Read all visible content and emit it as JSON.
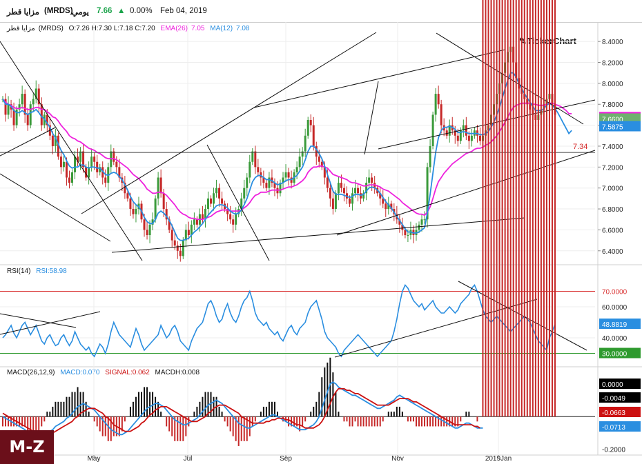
{
  "header": {
    "name": "مزايا قطر",
    "symbol": "(MRDS)",
    "period": "يومي",
    "last": "7.66",
    "change": "0.00%",
    "date": "Feb 04, 2019",
    "up_color": "#1aa34a"
  },
  "watermark": "TickerChart",
  "logo_text": "M-Z",
  "price_legend": {
    "name": "مزايا قطر",
    "symbol": "(MRDS)",
    "ohlc": "O:7.26  H:7.30  L:7.18  C:7.20",
    "ema_label": "EMA(26)",
    "ema_value": "7.05",
    "ma_label": "MA(12)",
    "ma_value": "7.08"
  },
  "rsi_legend": {
    "label": "RSI(14)",
    "value": "RSI:58.98"
  },
  "macd_legend": {
    "label": "MACD(26,12,9)",
    "macd": "MACD:0.070",
    "signal": "SIGNAL:0.062",
    "macdh": "MACDH:0.008"
  },
  "colors": {
    "ema": "#ee22dd",
    "ma": "#2a8ee0",
    "up": "#3a9a3a",
    "down": "#c62828",
    "macd_line": "#2a8ee0",
    "signal_line": "#cc1111",
    "hist_up": "#111111",
    "hist_down": "#c62828",
    "overbought": "#d93030",
    "oversold": "#2e9a2e"
  },
  "chart_data": [
    {
      "type": "candlestick",
      "title": "مزايا قطر (MRDS)",
      "x_tick_labels": [
        "May",
        "Jul",
        "Sep",
        "Nov",
        "2019Jan"
      ],
      "y_tick_labels": [
        "8.4000",
        "8.2000",
        "8.0000",
        "7.8000",
        "7.6000",
        "7.4000",
        "7.2000",
        "7.0000",
        "6.8000",
        "6.6000",
        "6.4000"
      ],
      "ylim": [
        6.28,
        8.48
      ],
      "n_bars": 200,
      "close": [
        7.85,
        7.7,
        7.8,
        7.75,
        7.6,
        7.75,
        7.8,
        7.9,
        7.7,
        7.6,
        7.8,
        7.85,
        7.95,
        7.8,
        7.6,
        7.7,
        7.6,
        7.5,
        7.4,
        7.5,
        7.3,
        7.2,
        7.25,
        7.1,
        7.05,
        7.15,
        7.3,
        7.25,
        7.35,
        7.2,
        7.1,
        7.2,
        7.3,
        7.25,
        7.15,
        7.2,
        7.1,
        7.05,
        7.2,
        7.35,
        7.25,
        7.2,
        7.1,
        7.05,
        6.95,
        6.9,
        6.8,
        6.75,
        6.8,
        6.85,
        6.7,
        6.6,
        6.55,
        6.65,
        6.7,
        6.9,
        7.1,
        6.95,
        6.8,
        6.7,
        6.6,
        6.5,
        6.45,
        6.4,
        6.35,
        6.5,
        6.6,
        6.55,
        6.65,
        6.7,
        6.65,
        6.75,
        6.7,
        6.8,
        6.9,
        6.85,
        6.95,
        7.0,
        6.9,
        6.85,
        6.8,
        6.75,
        6.7,
        6.65,
        6.75,
        6.8,
        6.9,
        7.0,
        7.1,
        7.25,
        7.35,
        7.2,
        7.15,
        7.1,
        7.05,
        7.0,
        7.1,
        7.05,
        7.0,
        6.95,
        7.05,
        7.1,
        7.15,
        7.1,
        7.05,
        7.15,
        7.2,
        7.3,
        7.35,
        7.5,
        7.65,
        7.6,
        7.4,
        7.3,
        7.25,
        7.2,
        7.1,
        7.0,
        6.9,
        6.8,
        6.95,
        7.05,
        7.0,
        6.95,
        6.9,
        6.85,
        6.95,
        7.0,
        6.95,
        6.9,
        6.95,
        7.05,
        7.1,
        7.05,
        7.0,
        6.95,
        6.9,
        6.85,
        6.8,
        6.85,
        6.8,
        6.75,
        6.7,
        6.65,
        6.6,
        6.55,
        6.55,
        6.6,
        6.55,
        6.6,
        6.65,
        6.7,
        6.7,
        7.2,
        7.4,
        7.7,
        7.9,
        7.8,
        7.6,
        7.55,
        7.5,
        7.6,
        7.55,
        7.5,
        7.45,
        7.55,
        7.6,
        7.5,
        7.45,
        7.5,
        7.55,
        7.5,
        7.45,
        7.5,
        7.55,
        7.6,
        7.7,
        7.8,
        7.9,
        8.0,
        8.1,
        8.2,
        8.3,
        8.35,
        8.2,
        8.05,
        7.95,
        7.9,
        7.85,
        7.8,
        7.75,
        7.7,
        7.65,
        7.7,
        7.75,
        7.8,
        7.85,
        7.9,
        7.8,
        7.7,
        7.6,
        7.5,
        7.45,
        7.4,
        7.35,
        7.66
      ],
      "ma12": [
        7.85,
        7.8,
        7.8,
        7.78,
        7.74,
        7.72,
        7.72,
        7.74,
        7.72,
        7.7,
        7.72,
        7.73,
        7.75,
        7.72,
        7.68,
        7.66,
        7.62,
        7.58,
        7.52,
        7.48,
        7.42,
        7.36,
        7.32,
        7.26,
        7.21,
        7.19,
        7.2,
        7.2,
        7.22,
        7.22,
        7.2,
        7.19,
        7.2,
        7.2,
        7.19,
        7.19,
        7.16,
        7.13,
        7.12,
        7.14,
        7.15,
        7.14,
        7.11,
        7.08,
        7.03,
        6.98,
        6.92,
        6.87,
        6.84,
        6.82,
        6.78,
        6.72,
        6.68,
        6.66,
        6.66,
        6.7,
        6.76,
        6.78,
        6.76,
        6.73,
        6.69,
        6.64,
        6.58,
        6.52,
        6.5,
        6.5,
        6.51,
        6.52,
        6.55,
        6.58,
        6.6,
        6.63,
        6.66,
        6.7,
        6.74,
        6.77,
        6.8,
        6.83,
        6.84,
        6.84,
        6.83,
        6.81,
        6.78,
        6.76,
        6.75,
        6.76,
        6.79,
        6.84,
        6.9,
        6.98,
        7.06,
        7.1,
        7.12,
        7.12,
        7.1,
        7.08,
        7.08,
        7.07,
        7.05,
        7.03,
        7.04,
        7.05,
        7.07,
        7.08,
        7.08,
        7.1,
        7.12,
        7.16,
        7.2,
        7.27,
        7.35,
        7.4,
        7.4,
        7.37,
        7.33,
        7.28,
        7.21,
        7.13,
        7.05,
        6.97,
        6.94,
        6.94,
        6.94,
        6.93,
        6.92,
        6.91,
        6.92,
        6.94,
        6.94,
        6.93,
        6.94,
        6.97,
        7.0,
        7.01,
        7.0,
        6.98,
        6.95,
        6.91,
        6.87,
        6.84,
        6.81,
        6.77,
        6.73,
        6.69,
        6.65,
        6.61,
        6.58,
        6.58,
        6.57,
        6.57,
        6.58,
        6.6,
        6.62,
        6.76,
        6.94,
        7.14,
        7.34,
        7.48,
        7.55,
        7.58,
        7.58,
        7.59,
        7.58,
        7.56,
        7.53,
        7.53,
        7.54,
        7.53,
        7.52,
        7.52,
        7.52,
        7.52,
        7.51,
        7.51,
        7.52,
        7.54,
        7.58,
        7.63,
        7.7,
        7.77,
        7.86,
        7.95,
        8.03,
        8.1,
        8.1,
        8.06,
        8.0,
        7.95,
        7.9,
        7.86,
        7.82,
        7.78,
        7.74,
        7.74,
        7.74,
        7.76,
        7.79,
        7.81,
        7.79,
        7.76,
        7.72,
        7.67,
        7.62,
        7.57,
        7.52,
        7.55
      ],
      "ema26": [
        7.85,
        7.82,
        7.8,
        7.79,
        7.77,
        7.76,
        7.76,
        7.77,
        7.76,
        7.75,
        7.75,
        7.76,
        7.77,
        7.77,
        7.75,
        7.75,
        7.73,
        7.71,
        7.68,
        7.67,
        7.64,
        7.6,
        7.57,
        7.54,
        7.5,
        7.48,
        7.47,
        7.45,
        7.44,
        7.42,
        7.4,
        7.38,
        7.37,
        7.36,
        7.34,
        7.33,
        7.31,
        7.29,
        7.28,
        7.28,
        7.28,
        7.27,
        7.25,
        7.23,
        7.21,
        7.19,
        7.16,
        7.13,
        7.11,
        7.09,
        7.06,
        7.03,
        6.99,
        6.97,
        6.95,
        6.95,
        6.96,
        6.96,
        6.95,
        6.93,
        6.9,
        6.87,
        6.84,
        6.8,
        6.77,
        6.75,
        6.74,
        6.72,
        6.71,
        6.71,
        6.7,
        6.7,
        6.7,
        6.71,
        6.72,
        6.73,
        6.75,
        6.77,
        6.78,
        6.79,
        6.79,
        6.79,
        6.78,
        6.78,
        6.78,
        6.78,
        6.79,
        6.81,
        6.83,
        6.86,
        6.9,
        6.93,
        6.94,
        6.96,
        6.96,
        6.96,
        6.97,
        6.98,
        6.98,
        6.98,
        6.98,
        6.99,
        7.0,
        7.01,
        7.01,
        7.02,
        7.03,
        7.05,
        7.07,
        7.1,
        7.15,
        7.18,
        7.2,
        7.2,
        7.21,
        7.21,
        7.2,
        7.19,
        7.16,
        7.13,
        7.12,
        7.11,
        7.1,
        7.09,
        7.08,
        7.06,
        7.05,
        7.05,
        7.04,
        7.03,
        7.02,
        7.02,
        7.03,
        7.03,
        7.03,
        7.02,
        7.01,
        6.99,
        6.98,
        6.97,
        6.95,
        6.93,
        6.91,
        6.89,
        6.86,
        6.84,
        6.82,
        6.8,
        6.78,
        6.76,
        6.75,
        6.75,
        6.74,
        6.77,
        6.82,
        6.9,
        6.99,
        7.06,
        7.1,
        7.14,
        7.17,
        7.2,
        7.23,
        7.25,
        7.27,
        7.29,
        7.31,
        7.33,
        7.34,
        7.35,
        7.37,
        7.38,
        7.38,
        7.39,
        7.41,
        7.42,
        7.44,
        7.47,
        7.5,
        7.54,
        7.58,
        7.63,
        7.68,
        7.73,
        7.77,
        7.79,
        7.8,
        7.81,
        7.81,
        7.81,
        7.81,
        7.8,
        7.8,
        7.79,
        7.79,
        7.79,
        7.8,
        7.81,
        7.81,
        7.8,
        7.79,
        7.78,
        7.76,
        7.74,
        7.71,
        7.71
      ],
      "right_labels": [
        {
          "text": "7.6747",
          "value": 7.6747,
          "bg": "#ee22dd",
          "fg": "#ffffff"
        },
        {
          "text": "7.6600",
          "value": 7.66,
          "bg": "#6fb06f",
          "fg": "#ffffff"
        },
        {
          "text": "7.5875",
          "value": 7.5875,
          "bg": "#2a8ee0",
          "fg": "#ffffff"
        }
      ],
      "support_line": {
        "value": 7.34,
        "label": "7.34"
      }
    },
    {
      "type": "line",
      "title": "RSI(14)",
      "y_tick_labels": [
        "60.0000",
        "40.0000"
      ],
      "ylim": [
        24,
        80
      ],
      "overbought": {
        "value": 70,
        "label": "70.0000"
      },
      "oversold": {
        "value": 30,
        "label": "30.0000"
      },
      "current": {
        "value": 48.8819,
        "label": "48.8819"
      },
      "values": [
        40,
        42,
        45,
        48,
        43,
        40,
        44,
        48,
        50,
        46,
        42,
        45,
        48,
        43,
        38,
        36,
        40,
        42,
        38,
        35,
        36,
        40,
        42,
        38,
        35,
        38,
        44,
        40,
        36,
        34,
        32,
        34,
        30,
        28,
        32,
        36,
        34,
        30,
        36,
        44,
        50,
        46,
        42,
        40,
        38,
        36,
        34,
        40,
        46,
        42,
        36,
        32,
        34,
        36,
        38,
        40,
        42,
        48,
        44,
        40,
        42,
        46,
        48,
        44,
        38,
        36,
        34,
        32,
        38,
        42,
        46,
        48,
        50,
        56,
        62,
        64,
        60,
        54,
        50,
        52,
        58,
        62,
        56,
        52,
        50,
        54,
        60,
        64,
        66,
        70,
        64,
        56,
        52,
        50,
        48,
        50,
        46,
        44,
        42,
        44,
        40,
        38,
        42,
        46,
        48,
        44,
        42,
        46,
        48,
        50,
        56,
        60,
        62,
        64,
        58,
        52,
        44,
        40,
        38,
        36,
        34,
        30,
        28,
        32,
        34,
        36,
        38,
        40,
        42,
        40,
        38,
        36,
        34,
        32,
        30,
        28,
        30,
        32,
        34,
        36,
        38,
        44,
        52,
        62,
        70,
        74,
        72,
        68,
        64,
        62,
        60,
        62,
        58,
        60,
        62,
        64,
        60,
        58,
        56,
        56,
        58,
        60,
        58,
        56,
        58,
        62,
        64,
        66,
        68,
        72,
        74,
        70,
        64,
        58,
        54,
        52,
        50,
        52,
        54,
        52,
        50,
        48,
        46,
        44,
        46,
        48,
        50,
        52,
        54,
        52,
        50,
        46,
        42,
        38,
        36,
        34,
        32,
        40,
        44,
        48.88
      ]
    },
    {
      "type": "line",
      "title": "MACD(26,12,9)",
      "y_tick_labels": [
        "-0.2000"
      ],
      "ylim": [
        -0.235,
        0.245
      ],
      "right_labels": [
        {
          "text": "0.0000",
          "value": 0.0,
          "bg": "#000000",
          "fg": "#ffffff"
        },
        {
          "text": "-0.0049",
          "value": -0.0049,
          "bg": "#000000",
          "fg": "#ffffff"
        },
        {
          "text": "-0.0663",
          "value": -0.0663,
          "bg": "#cc1111",
          "fg": "#ffffff"
        },
        {
          "text": "-0.0713",
          "value": -0.0713,
          "bg": "#2a8ee0",
          "fg": "#ffffff"
        }
      ],
      "macd": [
        0.0,
        -0.01,
        -0.02,
        -0.03,
        -0.04,
        -0.05,
        -0.06,
        -0.07,
        -0.08,
        -0.1,
        -0.12,
        -0.13,
        -0.14,
        -0.14,
        -0.13,
        -0.12,
        -0.1,
        -0.09,
        -0.08,
        -0.06,
        -0.05,
        -0.04,
        -0.03,
        -0.01,
        0.0,
        0.02,
        0.04,
        0.06,
        0.07,
        0.08,
        0.07,
        0.06,
        0.05,
        0.04,
        0.02,
        0.0,
        -0.02,
        -0.04,
        -0.06,
        -0.08,
        -0.09,
        -0.1,
        -0.11,
        -0.11,
        -0.1,
        -0.09,
        -0.07,
        -0.05,
        -0.03,
        -0.01,
        0.01,
        0.03,
        0.05,
        0.06,
        0.07,
        0.08,
        0.08,
        0.07,
        0.06,
        0.04,
        0.02,
        0.0,
        -0.02,
        -0.03,
        -0.04,
        -0.05,
        -0.05,
        -0.04,
        -0.03,
        -0.02,
        -0.01,
        0.01,
        0.03,
        0.05,
        0.07,
        0.08,
        0.09,
        0.1,
        0.09,
        0.08,
        0.06,
        0.04,
        0.02,
        0.0,
        -0.02,
        -0.04,
        -0.05,
        -0.06,
        -0.07,
        -0.07,
        -0.06,
        -0.05,
        -0.04,
        -0.03,
        -0.02,
        -0.01,
        0.0,
        0.01,
        0.01,
        0.0,
        -0.01,
        -0.02,
        -0.03,
        -0.04,
        -0.05,
        -0.06,
        -0.07,
        -0.08,
        -0.08,
        -0.08,
        -0.07,
        -0.06,
        -0.05,
        -0.03,
        0.0,
        0.05,
        0.1,
        0.15,
        0.2,
        0.21,
        0.2,
        0.18,
        0.17,
        0.16,
        0.15,
        0.14,
        0.13,
        0.13,
        0.12,
        0.11,
        0.1,
        0.09,
        0.08,
        0.07,
        0.06,
        0.05,
        0.05,
        0.06,
        0.07,
        0.08,
        0.09,
        0.1,
        0.12,
        0.13,
        0.12,
        0.11,
        0.1,
        0.09,
        0.08,
        0.07,
        0.06,
        0.05,
        0.04,
        0.03,
        0.02,
        0.01,
        0.0,
        -0.01,
        -0.02,
        -0.03,
        -0.04,
        -0.05,
        -0.06,
        -0.07,
        -0.07,
        -0.06,
        -0.05,
        -0.04,
        -0.04,
        -0.05,
        -0.06,
        -0.07,
        -0.07,
        -0.07
      ],
      "signal": [
        0.02,
        0.01,
        0.0,
        -0.01,
        -0.02,
        -0.03,
        -0.04,
        -0.05,
        -0.06,
        -0.07,
        -0.08,
        -0.09,
        -0.1,
        -0.11,
        -0.11,
        -0.11,
        -0.11,
        -0.1,
        -0.1,
        -0.09,
        -0.08,
        -0.07,
        -0.06,
        -0.05,
        -0.04,
        -0.03,
        -0.01,
        0.0,
        0.02,
        0.03,
        0.04,
        0.05,
        0.05,
        0.05,
        0.04,
        0.03,
        0.02,
        0.0,
        -0.01,
        -0.03,
        -0.05,
        -0.06,
        -0.07,
        -0.08,
        -0.09,
        -0.09,
        -0.09,
        -0.08,
        -0.07,
        -0.06,
        -0.04,
        -0.03,
        -0.01,
        0.01,
        0.02,
        0.04,
        0.05,
        0.06,
        0.06,
        0.06,
        0.05,
        0.04,
        0.03,
        0.02,
        0.01,
        0.0,
        -0.01,
        -0.02,
        -0.03,
        -0.03,
        -0.03,
        -0.02,
        -0.01,
        0.0,
        0.02,
        0.03,
        0.05,
        0.06,
        0.07,
        0.07,
        0.07,
        0.06,
        0.05,
        0.04,
        0.03,
        0.02,
        0.0,
        -0.01,
        -0.02,
        -0.03,
        -0.04,
        -0.04,
        -0.04,
        -0.04,
        -0.04,
        -0.03,
        -0.03,
        -0.02,
        -0.02,
        -0.01,
        -0.01,
        -0.01,
        -0.02,
        -0.02,
        -0.03,
        -0.04,
        -0.05,
        -0.05,
        -0.06,
        -0.07,
        -0.07,
        -0.07,
        -0.07,
        -0.06,
        -0.05,
        -0.03,
        0.0,
        0.04,
        0.08,
        0.12,
        0.15,
        0.17,
        0.17,
        0.17,
        0.16,
        0.16,
        0.15,
        0.14,
        0.14,
        0.13,
        0.12,
        0.11,
        0.1,
        0.09,
        0.08,
        0.07,
        0.07,
        0.07,
        0.07,
        0.07,
        0.08,
        0.09,
        0.1,
        0.11,
        0.11,
        0.11,
        0.11,
        0.1,
        0.09,
        0.09,
        0.08,
        0.07,
        0.06,
        0.05,
        0.04,
        0.03,
        0.02,
        0.01,
        0.0,
        -0.01,
        -0.02,
        -0.03,
        -0.04,
        -0.05,
        -0.05,
        -0.05,
        -0.05,
        -0.05,
        -0.05,
        -0.05,
        -0.06,
        -0.06,
        -0.07
      ]
    }
  ]
}
